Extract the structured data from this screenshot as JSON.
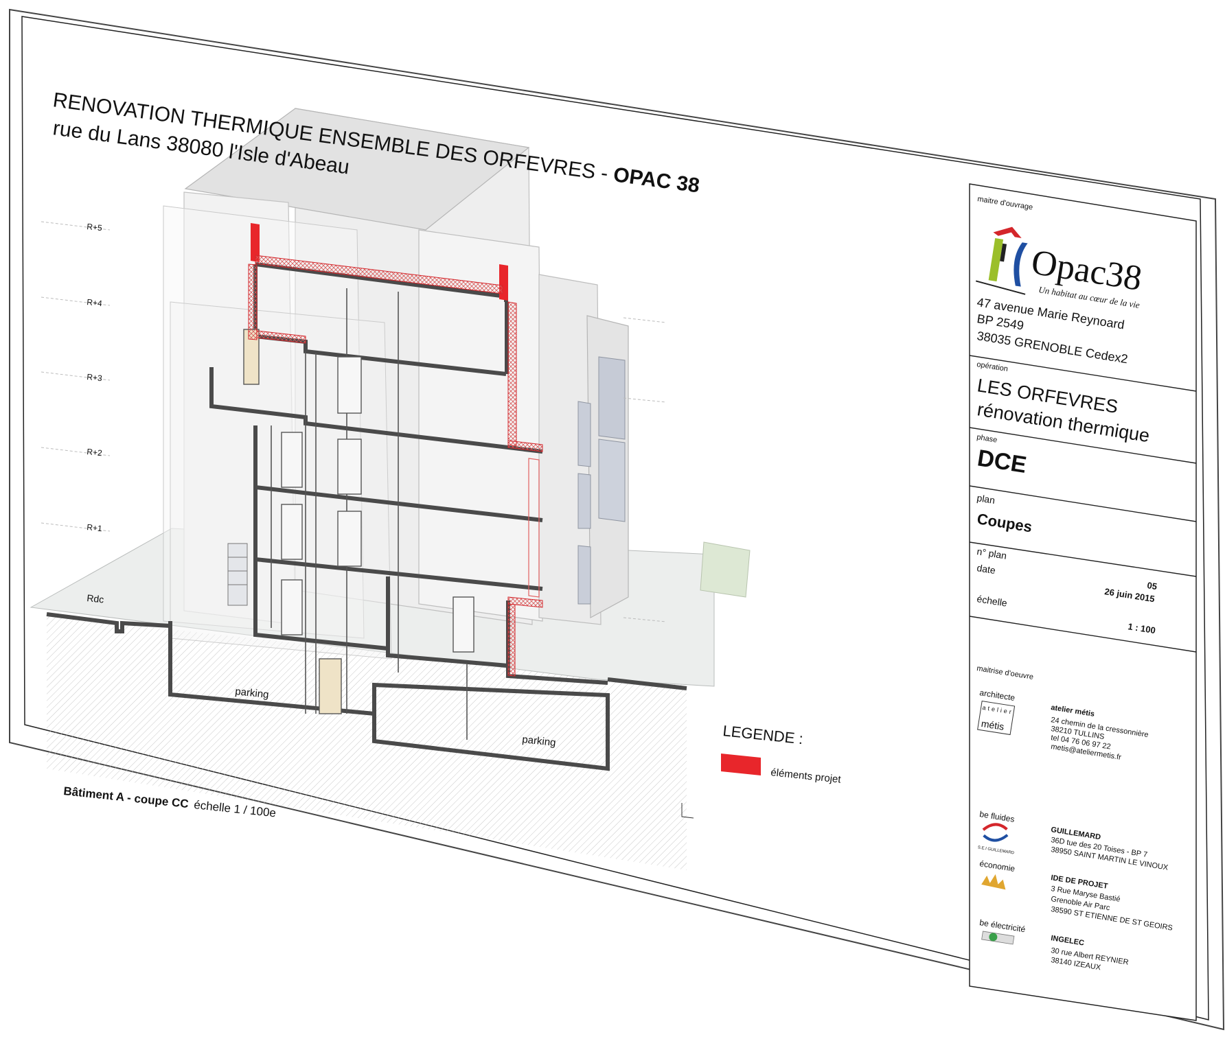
{
  "drawing": {
    "title_line1_main": "RENOVATION THERMIQUE ENSEMBLE DES ORFEVRES - ",
    "title_line1_bold": "OPAC 38",
    "title_line2": "rue du Lans 38080 l'Isle d'Abeau",
    "levels": [
      "R+5",
      "R+4",
      "R+3",
      "R+2",
      "R+1",
      "Rdc"
    ],
    "parking_labels": [
      "parking",
      "parking"
    ],
    "caption_bold": "Bâtiment A - coupe CC",
    "caption_scale": "échelle 1 / 100e",
    "legend_title": "LEGENDE :",
    "legend_item": "éléments projet",
    "legend_color": "#e8262b",
    "section_color": "#4a4a4a",
    "insulation_color": "#d4262b"
  },
  "cartouche": {
    "maitre_ouvrage_label": "maitre d'ouvrage",
    "logo_name": "Opac38",
    "logo_tagline": "Un habitat au cœur de la vie",
    "address": [
      "47 avenue Marie Reynoard",
      "BP 2549",
      "38035 GRENOBLE Cedex2"
    ],
    "operation_label": "opération",
    "operation_lines": [
      "LES ORFEVRES",
      "rénovation thermique"
    ],
    "phase_label": "phase",
    "phase_value": "DCE",
    "plan_label": "plan",
    "plan_value": "Coupes",
    "nplan_label": "n° plan",
    "nplan_value": "05",
    "date_label": "date",
    "date_value": "26 juin 2015",
    "echelle_label": "échelle",
    "echelle_value": "1 : 100",
    "maitrise_label": "maitrise d'oeuvre",
    "architecte_label": "architecte",
    "architecte_logo_top": "atelier",
    "architecte_logo_bottom": "métis",
    "architecte_name": "atelier métis",
    "architecte_lines": [
      "24 chemin de la cressonnière",
      "38210 TULLINS",
      "tel 04 76 06 97 22",
      "metis@ateliermetis.fr"
    ],
    "be_fluides_label": "be fluides",
    "fluides_logo_text": "S.E.I GUILLEMARD",
    "fluides_name": "GUILLEMARD",
    "fluides_lines": [
      "36D tue des 20 Toises - BP 7",
      "38950 SAINT MARTIN LE VINOUX"
    ],
    "economie_label": "économie",
    "economie_name": "IDE DE PROJET",
    "economie_lines": [
      "3 Rue Maryse Bastié",
      "Grenoble Air Parc",
      "38590 ST ETIENNE DE ST GEOIRS"
    ],
    "be_electricite_label": "be électricité",
    "electricite_name": "INGELEC",
    "electricite_lines": [
      "30 rue Albert REYNIER",
      "38140 IZEAUX"
    ]
  }
}
